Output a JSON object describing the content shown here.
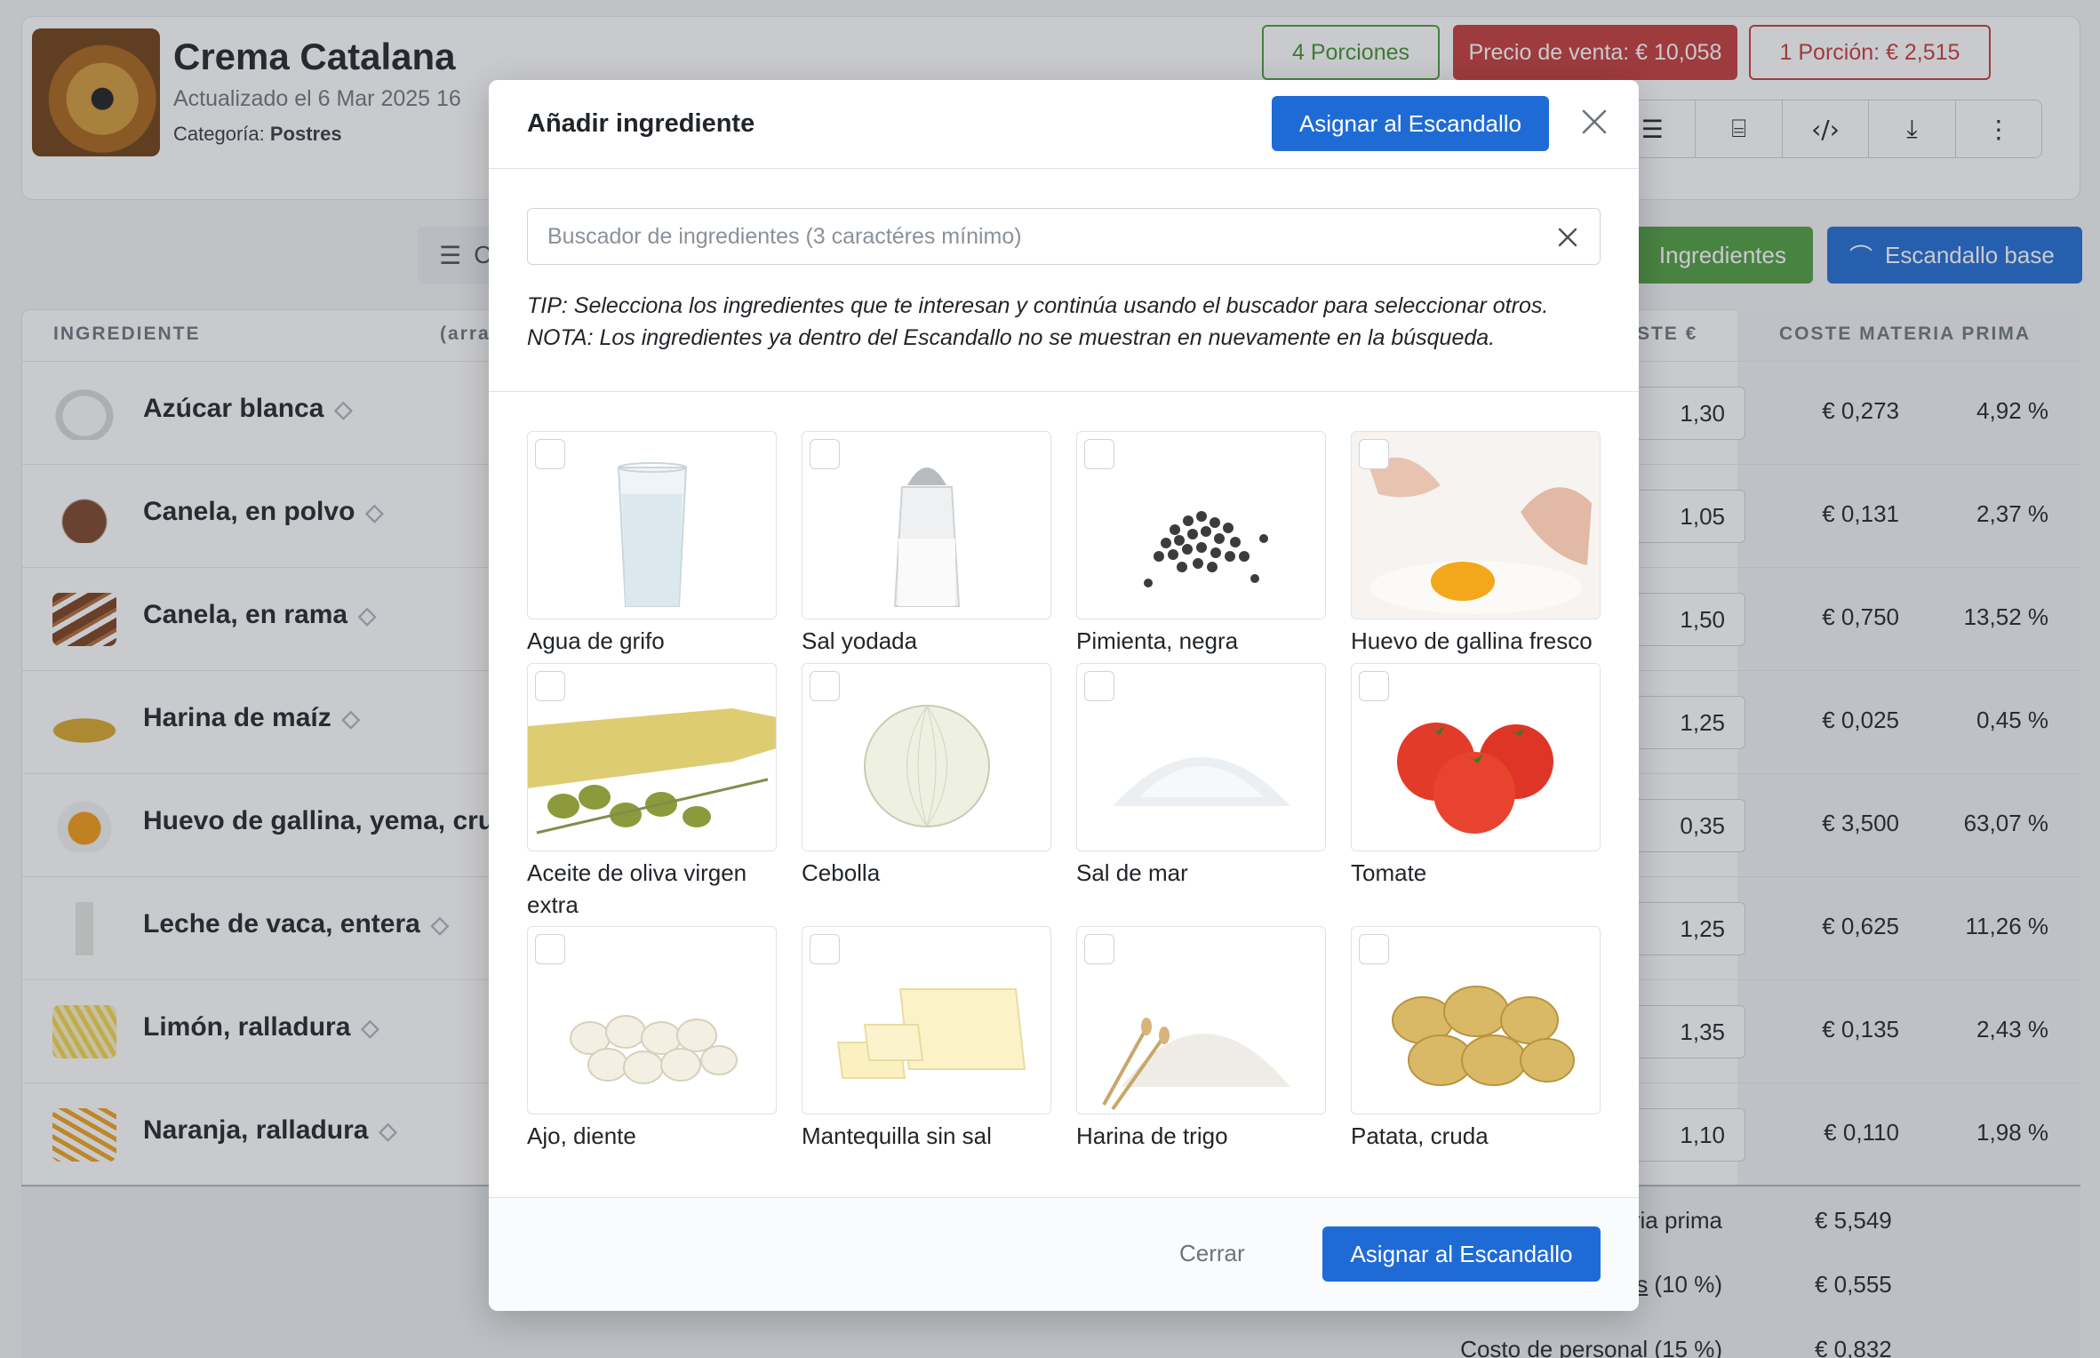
{
  "recipe": {
    "title": "Crema Catalana",
    "updated": "Actualizado el 6 Mar 2025 16",
    "category_label": "Categoría:",
    "category_value": "Postres"
  },
  "badges": {
    "portions": "4 Porciones",
    "sale_price": "Precio de venta: € 10,058",
    "portion_price": "1 Porción: € 2,515"
  },
  "toolbar": {
    "icons": [
      "ordered-list-icon",
      "blender-icon",
      "code-icon",
      "download-icon",
      "more-vertical-icon"
    ]
  },
  "actions": {
    "sort_label": "C",
    "ingredients_btn": "Ingredientes",
    "base_btn": "Escandallo base"
  },
  "table": {
    "headers": {
      "ingredient": "INGREDIENTE",
      "arr": "(arra",
      "cost": "STE €",
      "raw_cost": "COSTE MATERIA PRIMA"
    },
    "rows": [
      {
        "name": "Azúcar blanca",
        "qty": "1,30",
        "cost": "€ 0,273",
        "pct": "4,92 %"
      },
      {
        "name": "Canela, en polvo",
        "qty": "1,05",
        "cost": "€ 0,131",
        "pct": "2,37 %"
      },
      {
        "name": "Canela, en rama",
        "qty": "1,50",
        "cost": "€ 0,750",
        "pct": "13,52 %"
      },
      {
        "name": "Harina de maíz",
        "qty": "1,25",
        "cost": "€ 0,025",
        "pct": "0,45 %"
      },
      {
        "name": "Huevo de gallina, yema, crud",
        "qty": "0,35",
        "cost": "€ 3,500",
        "pct": "63,07 %"
      },
      {
        "name": "Leche de vaca, entera",
        "qty": "1,25",
        "cost": "€ 0,625",
        "pct": "11,26 %"
      },
      {
        "name": "Limón, ralladura",
        "qty": "1,35",
        "cost": "€ 0,135",
        "pct": "2,43 %"
      },
      {
        "name": "Naranja, ralladura",
        "qty": "1,10",
        "cost": "€ 0,110",
        "pct": "1,98 %"
      }
    ],
    "totals": [
      {
        "label": "ria prima",
        "value": "€ 5,549"
      },
      {
        "label_link": "s",
        "label_rest": " (10 %)",
        "value": "€ 0,555"
      },
      {
        "label": "Costo de personal (15 %)",
        "value": "€ 0,832"
      }
    ]
  },
  "modal": {
    "title": "Añadir ingrediente",
    "assign_label": "Asignar al Escandallo",
    "search_placeholder": "Buscador de ingredientes (3 caractéres mínimo)",
    "tip": "TIP: Selecciona los ingredientes que te interesan y continúa usando el buscador para seleccionar otros.",
    "note": "NOTA: Los ingredientes ya dentro del Escandallo no se muestran en nuevamente en la búsqueda.",
    "close_label": "Cerrar",
    "items": [
      {
        "name": "Agua de grifo"
      },
      {
        "name": "Sal yodada"
      },
      {
        "name": "Pimienta, negra"
      },
      {
        "name": "Huevo de gallina fresco"
      },
      {
        "name": "Aceite de oliva virgen extra"
      },
      {
        "name": "Cebolla"
      },
      {
        "name": "Sal de mar"
      },
      {
        "name": "Tomate"
      },
      {
        "name": "Ajo, diente"
      },
      {
        "name": "Mantequilla sin sal"
      },
      {
        "name": "Harina de trigo"
      },
      {
        "name": "Patata, cruda"
      }
    ]
  },
  "colors": {
    "primary": "#1f6bd6",
    "success": "#4e9d3f",
    "danger": "#c43a3a"
  }
}
